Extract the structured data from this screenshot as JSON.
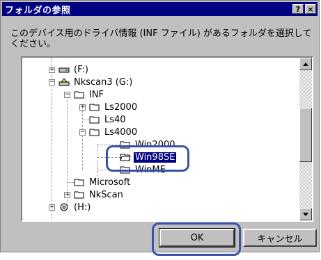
{
  "dialog": {
    "title": "フォルダの参照",
    "help_button": "?",
    "close_button": "×",
    "description": "このデバイス用のドライバ情報 (INF ファイル) があるフォルダを選択してください。"
  },
  "tree": {
    "items": [
      {
        "label": "(F:)",
        "icon": "drive-icon"
      },
      {
        "label": "Nkscan3 (G:)",
        "icon": "network-drive-icon"
      },
      {
        "label": "INF",
        "icon": "folder-open-icon"
      },
      {
        "label": "Ls2000",
        "icon": "folder-icon"
      },
      {
        "label": "Ls40",
        "icon": "folder-icon"
      },
      {
        "label": "Ls4000",
        "icon": "folder-open-icon"
      },
      {
        "label": "Win2000",
        "icon": "folder-icon"
      },
      {
        "label": "Win98SE",
        "icon": "folder-open-icon"
      },
      {
        "label": "WinME",
        "icon": "folder-icon"
      },
      {
        "label": "Microsoft",
        "icon": "folder-icon"
      },
      {
        "label": "NkScan",
        "icon": "folder-icon"
      },
      {
        "label": "(H:)",
        "icon": "cd-drive-icon"
      }
    ]
  },
  "buttons": {
    "ok": "OK",
    "cancel": "キャンセル"
  },
  "colors": {
    "titlebar": "#000080",
    "highlight_ring": "#3a52a8",
    "face": "#c0c0c0"
  }
}
